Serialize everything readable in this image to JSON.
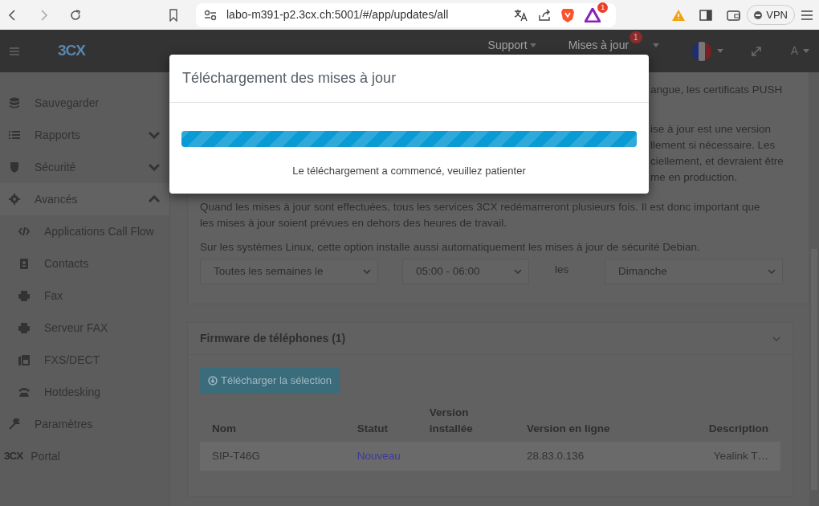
{
  "browser": {
    "url": "labo-m391-p2.3cx.ch:5001/#/app/updates/all",
    "alert_badge": "1",
    "vpn": "VPN"
  },
  "navbar": {
    "logo": "3CX",
    "menus": [
      {
        "label": "Support"
      },
      {
        "label": "Mises à jour",
        "badge": "1"
      }
    ],
    "user": "A"
  },
  "sidebar": {
    "items": [
      {
        "label": "Sauvegarder"
      },
      {
        "label": "Rapports",
        "expanded": false
      },
      {
        "label": "Sécurité",
        "expanded": false
      },
      {
        "label": "Avancés",
        "expanded": true,
        "children": [
          {
            "label": "Applications Call Flow"
          },
          {
            "label": "Contacts"
          },
          {
            "label": "Fax"
          },
          {
            "label": "Serveur FAX"
          },
          {
            "label": "FXS/DECT"
          },
          {
            "label": "Hotdesking"
          }
        ]
      },
      {
        "label": "Paramètres"
      },
      {
        "label": "Portal",
        "icon_text": "3CX"
      }
    ]
  },
  "updates_card": {
    "partial_lines": [
      [
        "angue, les certificats PUSH"
      ],
      [
        "ise à jour est une version",
        "llement si nécessaire. Les",
        "ciellement, et devraient être",
        "me en production."
      ]
    ],
    "paragraphs": [
      "Quand les mises à jour sont effectuées, tous les services 3CX redémarreront plusieurs fois. Il est donc important que les mises à jour soient prévues en dehors des heures de travail.",
      "Sur les systèmes Linux, cette option installe aussi automatiquement les mises à jour de sécurité Debian."
    ],
    "schedule": {
      "frequency": "Toutes les semaines le",
      "time": "05:00 - 06:00",
      "connector": "les",
      "day": "Dimanche"
    }
  },
  "firmware_card": {
    "title": "Firmware de téléphones (1)",
    "button": "Télécharger la sélection",
    "table": {
      "columns": [
        "Nom",
        "Statut",
        "Version installée",
        "Version en ligne",
        "Description"
      ],
      "rows": [
        {
          "cells": [
            "SIP-T46G",
            "Nouveau",
            "",
            "28.83.0.136",
            "Yealink T…"
          ]
        }
      ]
    }
  },
  "modal": {
    "title": "Téléchargement des mises à jour",
    "progress": {
      "level": 1
    },
    "message": "Le téléchargement a commencé, veuillez patienter"
  }
}
